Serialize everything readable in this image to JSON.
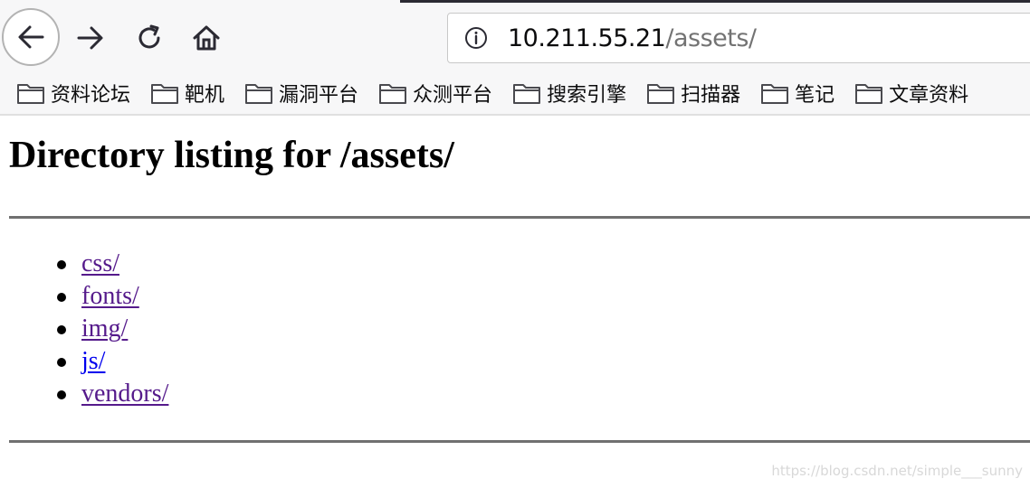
{
  "browser": {
    "url_host": "10.211.55.21",
    "url_path": "/assets/",
    "nav_icons": [
      "back-arrow-icon",
      "forward-arrow-icon",
      "reload-icon",
      "home-icon"
    ],
    "bookmarks": [
      {
        "label": "资料论坛"
      },
      {
        "label": "靶机"
      },
      {
        "label": "漏洞平台"
      },
      {
        "label": "众测平台"
      },
      {
        "label": "搜索引擎"
      },
      {
        "label": "扫描器"
      },
      {
        "label": "笔记"
      },
      {
        "label": "文章资料"
      }
    ],
    "colors": {
      "chrome_bg": "#f7f7f8",
      "visited_link": "#551a8b",
      "unvisited_link": "#0000ee"
    }
  },
  "page": {
    "title": "Directory listing for /assets/",
    "entries": [
      {
        "label": "css/",
        "visited": true
      },
      {
        "label": "fonts/",
        "visited": true
      },
      {
        "label": "img/",
        "visited": true
      },
      {
        "label": "js/",
        "visited": false
      },
      {
        "label": "vendors/",
        "visited": true
      }
    ]
  },
  "watermark": "https://blog.csdn.net/simple___sunny"
}
